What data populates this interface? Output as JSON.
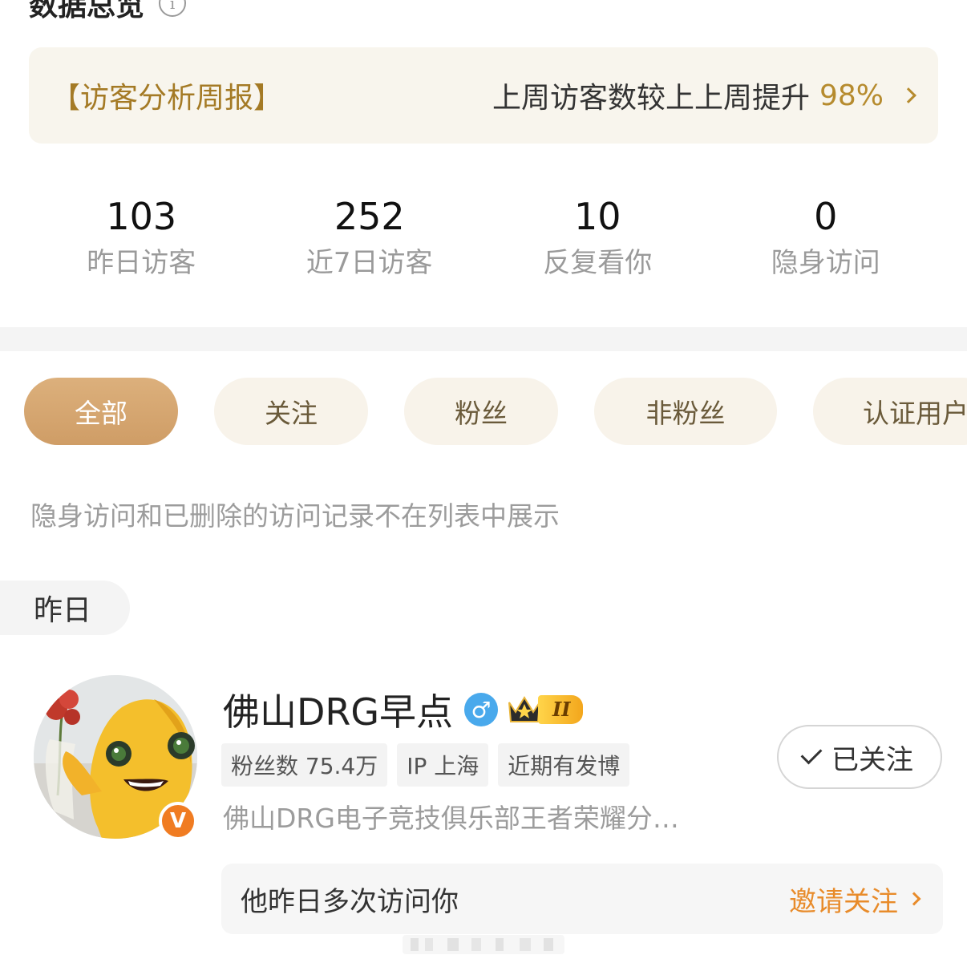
{
  "header": {
    "title": "数据总览",
    "info_icon": "info-icon"
  },
  "weekly_report": {
    "title": "【访客分析周报】",
    "summary": "上周访客数较上上周提升",
    "percent": "98%",
    "chevron_icon": "chevron-right-icon"
  },
  "stats": [
    {
      "value": "103",
      "label": "昨日访客"
    },
    {
      "value": "252",
      "label": "近7日访客"
    },
    {
      "value": "10",
      "label": "反复看你"
    },
    {
      "value": "0",
      "label": "隐身访问"
    }
  ],
  "filters": [
    {
      "label": "全部",
      "active": true
    },
    {
      "label": "关注",
      "active": false
    },
    {
      "label": "粉丝",
      "active": false
    },
    {
      "label": "非粉丝",
      "active": false
    },
    {
      "label": "认证用户",
      "active": false
    }
  ],
  "notice": "隐身访问和已删除的访问记录不在列表中展示",
  "day_group": "昨日",
  "visitor": {
    "name": "佛山DRG早点",
    "gender_icon": "male-icon",
    "gender_symbol": "♂",
    "level_text": "II",
    "verified_badge": "V",
    "tags": [
      "粉丝数 75.4万",
      "IP 上海",
      "近期有发博"
    ],
    "follow_label": "已关注",
    "description": "佛山DRG电子竞技俱乐部王者荣耀分…",
    "visit_note": "他昨日多次访问你",
    "invite_label": "邀请关注"
  },
  "colors": {
    "accent_gold": "#b68b2e",
    "active_chip": "#d4a46d",
    "chip_bg": "#f8f3ea",
    "invite_orange": "#e88b2a",
    "verified_orange": "#f07c22",
    "gender_blue": "#49a9ec"
  }
}
